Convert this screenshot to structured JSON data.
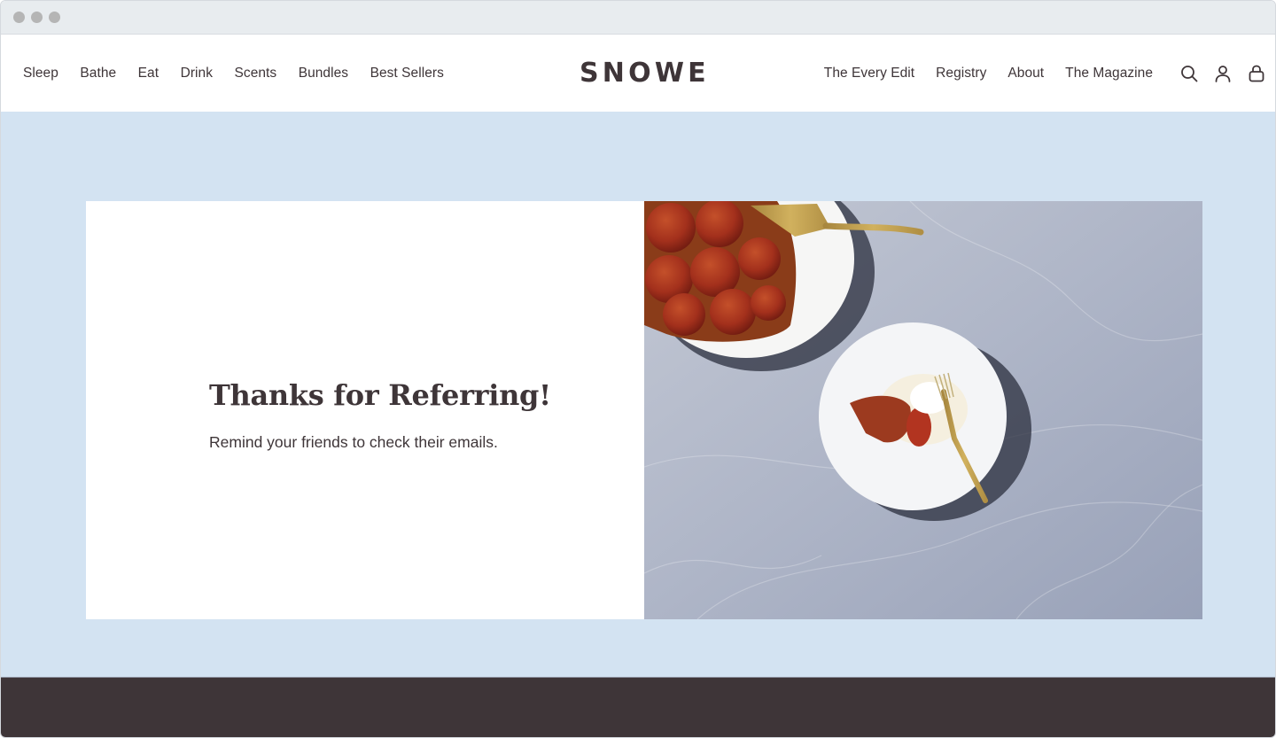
{
  "window": {
    "controls": [
      "close",
      "minimize",
      "maximize"
    ]
  },
  "header": {
    "logo": "SNOWE",
    "nav_left": [
      {
        "label": "Sleep"
      },
      {
        "label": "Bathe"
      },
      {
        "label": "Eat"
      },
      {
        "label": "Drink"
      },
      {
        "label": "Scents"
      },
      {
        "label": "Bundles"
      },
      {
        "label": "Best Sellers"
      }
    ],
    "nav_right": [
      {
        "label": "The Every Edit"
      },
      {
        "label": "Registry"
      },
      {
        "label": "About"
      },
      {
        "label": "The Magazine"
      }
    ],
    "icons": [
      "search-icon",
      "account-icon",
      "cart-bag-icon"
    ]
  },
  "hero": {
    "title": "Thanks for Referring!",
    "subtitle": "Remind your friends to check their emails.",
    "image_alt": "Tarte tatin on white plates with gold server and fork on marble"
  },
  "colors": {
    "text": "#3e3538",
    "hero_background": "#d3e3f2",
    "footer_background": "#3e3538",
    "titlebar": "#e8ecef"
  }
}
